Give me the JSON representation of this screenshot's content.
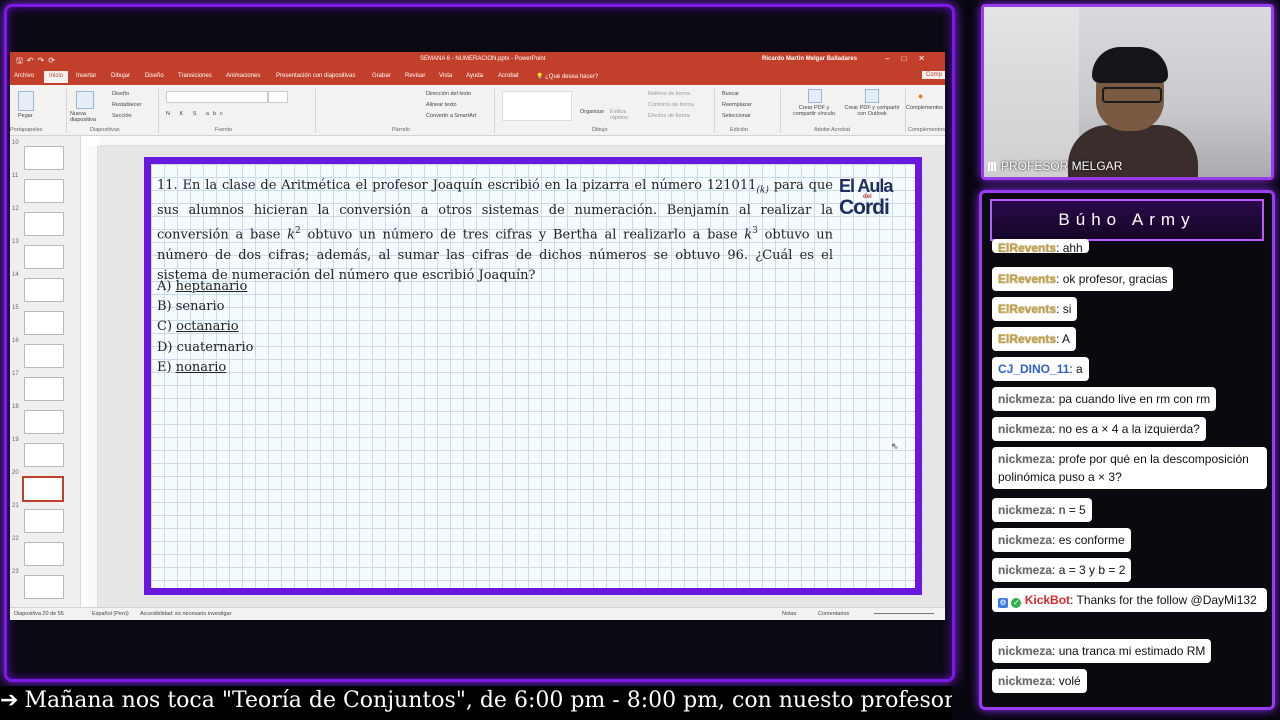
{
  "ppt": {
    "filename": "SEMANA 6 - NUMERACION.pptx - PowerPoint",
    "user": "Ricardo Martin Melgar Balladares",
    "tabs": [
      "Archivo",
      "Inicio",
      "Insertar",
      "Dibujar",
      "Diseño",
      "Transiciones",
      "Animaciones",
      "Presentación con diapositivas",
      "Grabar",
      "Revisar",
      "Vista",
      "Ayuda",
      "Acrobat",
      "¿Qué desea hacer?"
    ],
    "ribbon": {
      "groups": [
        "Portapapeles",
        "Diapositivas",
        "Fuente",
        "Párrafo",
        "Dibujo",
        "Edición",
        "Adobe Acrobat",
        "Complementos"
      ],
      "pegar": "Pegar",
      "nueva": "Nueva diapositiva",
      "diseno": "Diseño",
      "restablecer": "Restablecer",
      "seccion": "Sección",
      "direccion": "Dirección del texto",
      "alinear": "Alinear texto",
      "smartart": "Convertir a SmartArt",
      "organizar": "Organizar",
      "estilos": "Estilos rápidos",
      "relleno": "Relleno de forma",
      "contorno": "Contorno de forma",
      "efectos": "Efectos de forma",
      "buscar": "Buscar",
      "reemplazar": "Reemplazar",
      "seleccionar": "Seleccionar",
      "pdf1": "Crear PDF y compartir vínculo",
      "pdf2": "Crear PDF y compartir con Outlook",
      "complementos": "Complementos",
      "comp_btn": "Comp"
    },
    "thumb_numbers": [
      "10",
      "11",
      "12",
      "13",
      "14",
      "15",
      "16",
      "17",
      "18",
      "19",
      "20",
      "21",
      "22",
      "23"
    ],
    "status": {
      "slide": "Diapositiva 20 de 55",
      "lang": "Español (Perú)",
      "access": "Accesibilidad: es necesario investigar",
      "notes": "Notas",
      "comments": "Comentarios"
    }
  },
  "slide": {
    "number": "11.",
    "text_a": "En la clase de Aritmética el profesor Joaquín escribió en la pizarra el número 121011",
    "base_sub": "(k)",
    "text_b": " para que sus alumnos hicieran la conversión a otros sistemas de numeración. Benjamín al realizar la conversión a base ",
    "k1": "k",
    "exp1": "2",
    "text_c": " obtuvo un número de tres cifras y Bertha al realizarlo a base ",
    "k2": "k",
    "exp2": "3",
    "text_d": " obtuvo un número de dos cifras; además, al sumar las cifras de dichos números se obtuvo 96. ¿Cuál es el sistema de numeración del número que escribió Joaquín?",
    "options": [
      {
        "letter": "A)",
        "text": "heptanario"
      },
      {
        "letter": "B)",
        "text": "senario"
      },
      {
        "letter": "C)",
        "text": "octanario"
      },
      {
        "letter": "D)",
        "text": "cuaternario"
      },
      {
        "letter": "E)",
        "text": "nonario"
      }
    ],
    "logo": {
      "line1": "El Aula",
      "line2": "del",
      "line3": "Cordi"
    }
  },
  "webcam": {
    "name": "PROFESOR MELGAR"
  },
  "chat": {
    "title": "Búho Army",
    "messages": [
      {
        "user": "ElRevents",
        "text": ": ahh"
      },
      {
        "user": "ElRevents",
        "text": ": ok profesor, gracias"
      },
      {
        "user": "ElRevents",
        "text": ": si"
      },
      {
        "user": "ElRevents",
        "text": ": A"
      },
      {
        "user": "CJ_DINO_11",
        "text": ": a"
      },
      {
        "user": "nickmeza",
        "text": ": pa cuando live en rm con rm"
      },
      {
        "user": "nickmeza",
        "text": ": no es a × 4 a la izquierda?"
      },
      {
        "user": "nickmeza",
        "text": ": profe por qué en la descomposición polinómica puso a × 3?"
      },
      {
        "user": "nickmeza",
        "text": ": n = 5"
      },
      {
        "user": "nickmeza",
        "text": ": es conforme"
      },
      {
        "user": "nickmeza",
        "text": ": a = 3 y b = 2"
      },
      {
        "user": "KickBot",
        "text": ": Thanks for the follow @DayMi132"
      },
      {
        "user": "nickmeza",
        "text": ": una tranca mi estimado RM"
      },
      {
        "user": "nickmeza",
        "text": ": volé"
      }
    ]
  },
  "ticker": {
    "text": "Mañana nos toca \"Teoría de Conjuntos\", de 6:00 pm - 8:00 pm, con nuesto profesor Ricardo M"
  }
}
